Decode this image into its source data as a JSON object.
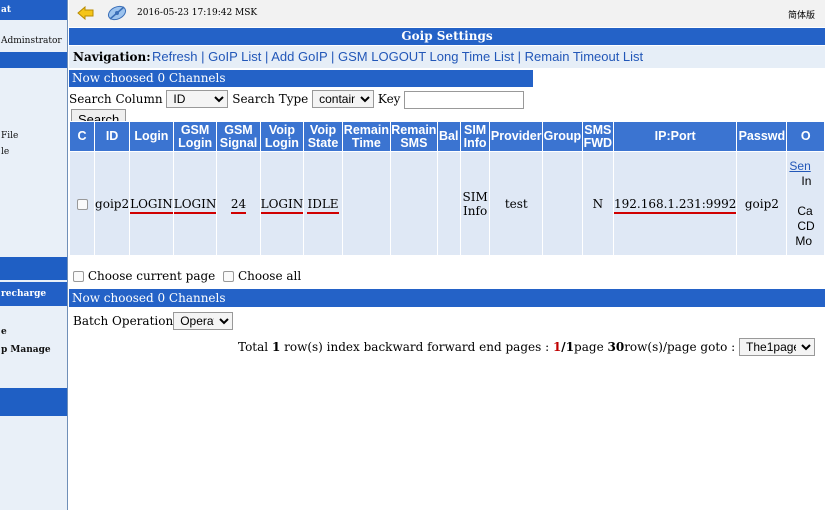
{
  "sidebar": {
    "header": "at",
    "user": "Adminstrator",
    "items": [
      "File",
      "le"
    ],
    "group_recharge": "recharge",
    "items2": [
      "e",
      "p Manage"
    ]
  },
  "topbar": {
    "datetime": "2016-05-23 17:19:42 MSK",
    "language": "简体版",
    "back_icon": "back-arrow-icon",
    "logo_icon": "satellite-logo-icon"
  },
  "title": "Goip Settings",
  "navigation": {
    "label": "Navigation:",
    "links": [
      "Refresh",
      "GoIP List",
      "Add GoIP",
      "GSM LOGOUT Long Time List",
      "Remain Timeout List"
    ]
  },
  "chosen_text": "Now choosed 0 Channels",
  "search": {
    "column_label": "Search Column",
    "column_value": "ID",
    "type_label": "Search Type",
    "type_value": "contain",
    "key_label": "Key",
    "key_value": "",
    "button": "Search"
  },
  "table": {
    "headers": [
      "C",
      "ID",
      "Login",
      "GSM Login",
      "GSM Signal",
      "Voip Login",
      "Voip State",
      "Remain Time",
      "Remain SMS",
      "Bal",
      "SIM Info",
      "Provider",
      "Group",
      "SMS FWD",
      "IP:Port",
      "Passwd",
      "O"
    ],
    "row": {
      "id": "goip2",
      "login": "LOGIN",
      "gsm_login": "LOGIN",
      "gsm_signal": "24",
      "voip_login": "LOGIN",
      "voip_state": "IDLE",
      "remain_time": "",
      "remain_sms": "",
      "bal": "",
      "sim_info": "SIM Info",
      "provider": "test",
      "group": "",
      "sms_fwd": "N",
      "ip_port": "192.168.1.231:9992",
      "passwd": "goip2",
      "ops": [
        "Sen",
        "In",
        "Ca",
        "CD",
        "Mo"
      ]
    }
  },
  "choose": {
    "current_page": "Choose current page",
    "all": "Choose all"
  },
  "batch": {
    "label": "Batch Operation",
    "value": "Operatio"
  },
  "pager": {
    "total_pre": "Total ",
    "total_count": "1",
    "total_post": " row(s)   index backward forward end  pages : ",
    "page_current": "1",
    "page_sep": "/",
    "page_total": "1",
    "page_word": "page  ",
    "per_page": "30",
    "per_page_post": "row(s)/page  goto : ",
    "goto_value": "The1page"
  }
}
